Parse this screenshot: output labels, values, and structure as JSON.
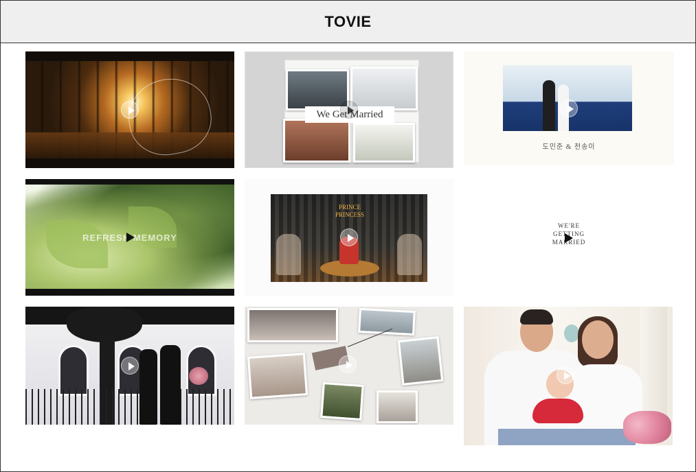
{
  "header": {
    "title": "TOVIE"
  },
  "thumbnails": [
    {
      "caption": ""
    },
    {
      "caption": "We Get Married"
    },
    {
      "names": "도민준 & 천송이",
      "date": ""
    },
    {
      "caption": "REFRESH MEMORY"
    },
    {
      "sign_line1": "PRINCE",
      "sign_line2": "PRINCESS"
    },
    {
      "headline_line1": "WE'RE",
      "headline_line2": "GETTING",
      "headline_line3": "MARRIED"
    },
    {
      "caption": ""
    },
    {
      "tag": ""
    },
    {
      "caption": ""
    }
  ]
}
